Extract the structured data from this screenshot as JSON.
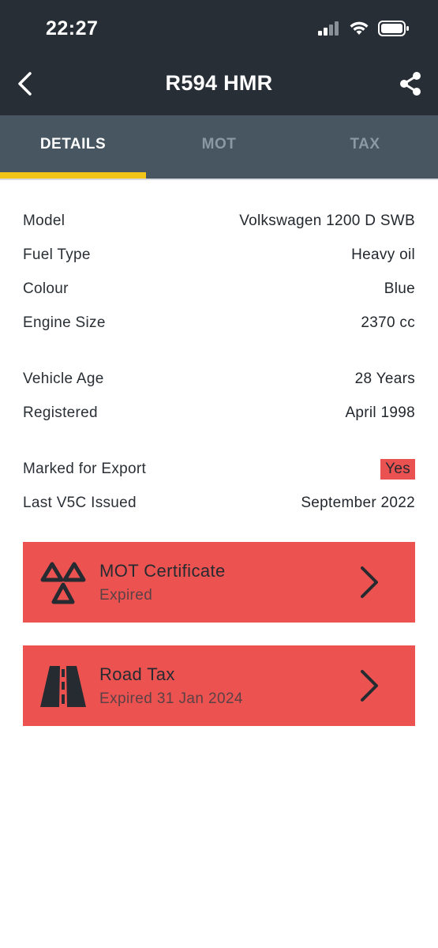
{
  "status_bar": {
    "time": "22:27"
  },
  "header": {
    "title": "R594 HMR"
  },
  "tabs": [
    {
      "label": "DETAILS",
      "active": true
    },
    {
      "label": "MOT",
      "active": false
    },
    {
      "label": "TAX",
      "active": false
    }
  ],
  "details": {
    "model": {
      "label": "Model",
      "value": "Volkswagen 1200 D SWB"
    },
    "fuel": {
      "label": "Fuel Type",
      "value": "Heavy oil"
    },
    "colour": {
      "label": "Colour",
      "value": "Blue"
    },
    "engine": {
      "label": "Engine Size",
      "value": "2370 cc"
    },
    "age": {
      "label": "Vehicle Age",
      "value": "28 Years"
    },
    "registered": {
      "label": "Registered",
      "value": "April 1998"
    },
    "export": {
      "label": "Marked for Export",
      "value": "Yes"
    },
    "v5c": {
      "label": "Last V5C Issued",
      "value": "September 2022"
    }
  },
  "cards": {
    "mot": {
      "title": "MOT Certificate",
      "subtitle": "Expired",
      "icon": "mot-triangles-icon"
    },
    "tax": {
      "title": "Road Tax",
      "subtitle": "Expired 31 Jan 2024",
      "icon": "road-icon"
    }
  },
  "colors": {
    "header_bg": "#272e35",
    "tabs_bg": "#475661",
    "tab_indicator": "#f2c418",
    "alert_red": "#ec5350"
  }
}
